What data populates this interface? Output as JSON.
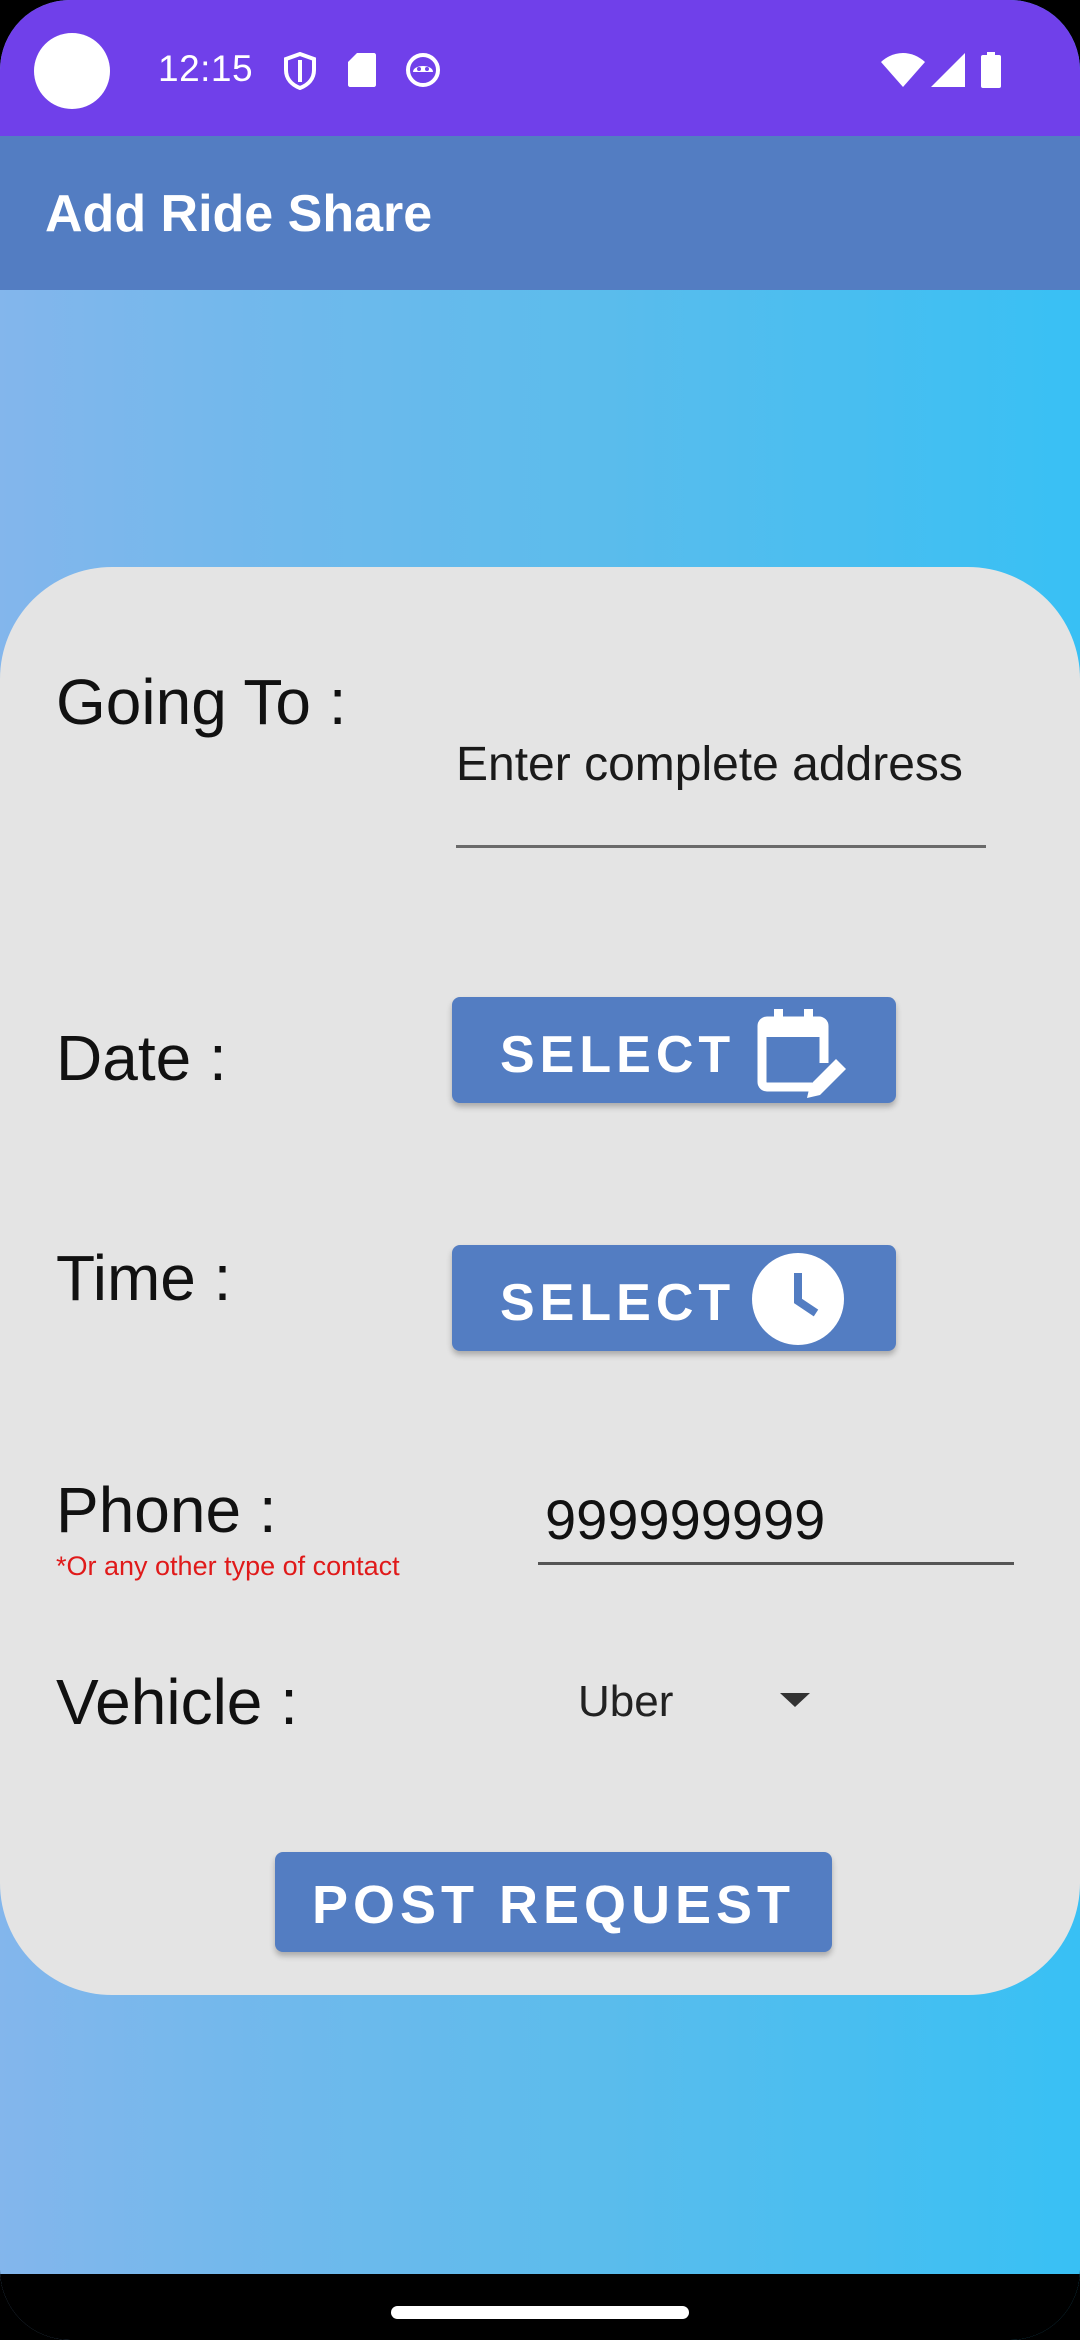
{
  "status_bar": {
    "time": "12:15",
    "left_icons": [
      "vpn-shield-icon",
      "sd-card-icon",
      "android-debug-icon"
    ],
    "right_icons": [
      "wifi-icon",
      "cell-signal-icon",
      "battery-icon"
    ]
  },
  "app_bar": {
    "title": "Add Ride Share"
  },
  "form": {
    "going_to": {
      "label": "Going To :",
      "placeholder": "Enter complete address"
    },
    "date": {
      "label": "Date :",
      "button_label": "SELECT",
      "icon": "calendar-edit-icon"
    },
    "time": {
      "label": "Time :",
      "button_label": "SELECT",
      "icon": "clock-icon"
    },
    "phone": {
      "label": "Phone :",
      "note": "*Or any other type of contact",
      "value": "999999999"
    },
    "vehicle": {
      "label": "Vehicle :",
      "selected": "Uber",
      "icon": "dropdown-arrow-icon"
    },
    "submit_label": "POST REQUEST"
  },
  "colors": {
    "status_bar": "#7040ea",
    "app_bar": "#537dc2",
    "button": "#537dc2",
    "card": "#e4e4e4",
    "note_text": "#e01a1a"
  }
}
